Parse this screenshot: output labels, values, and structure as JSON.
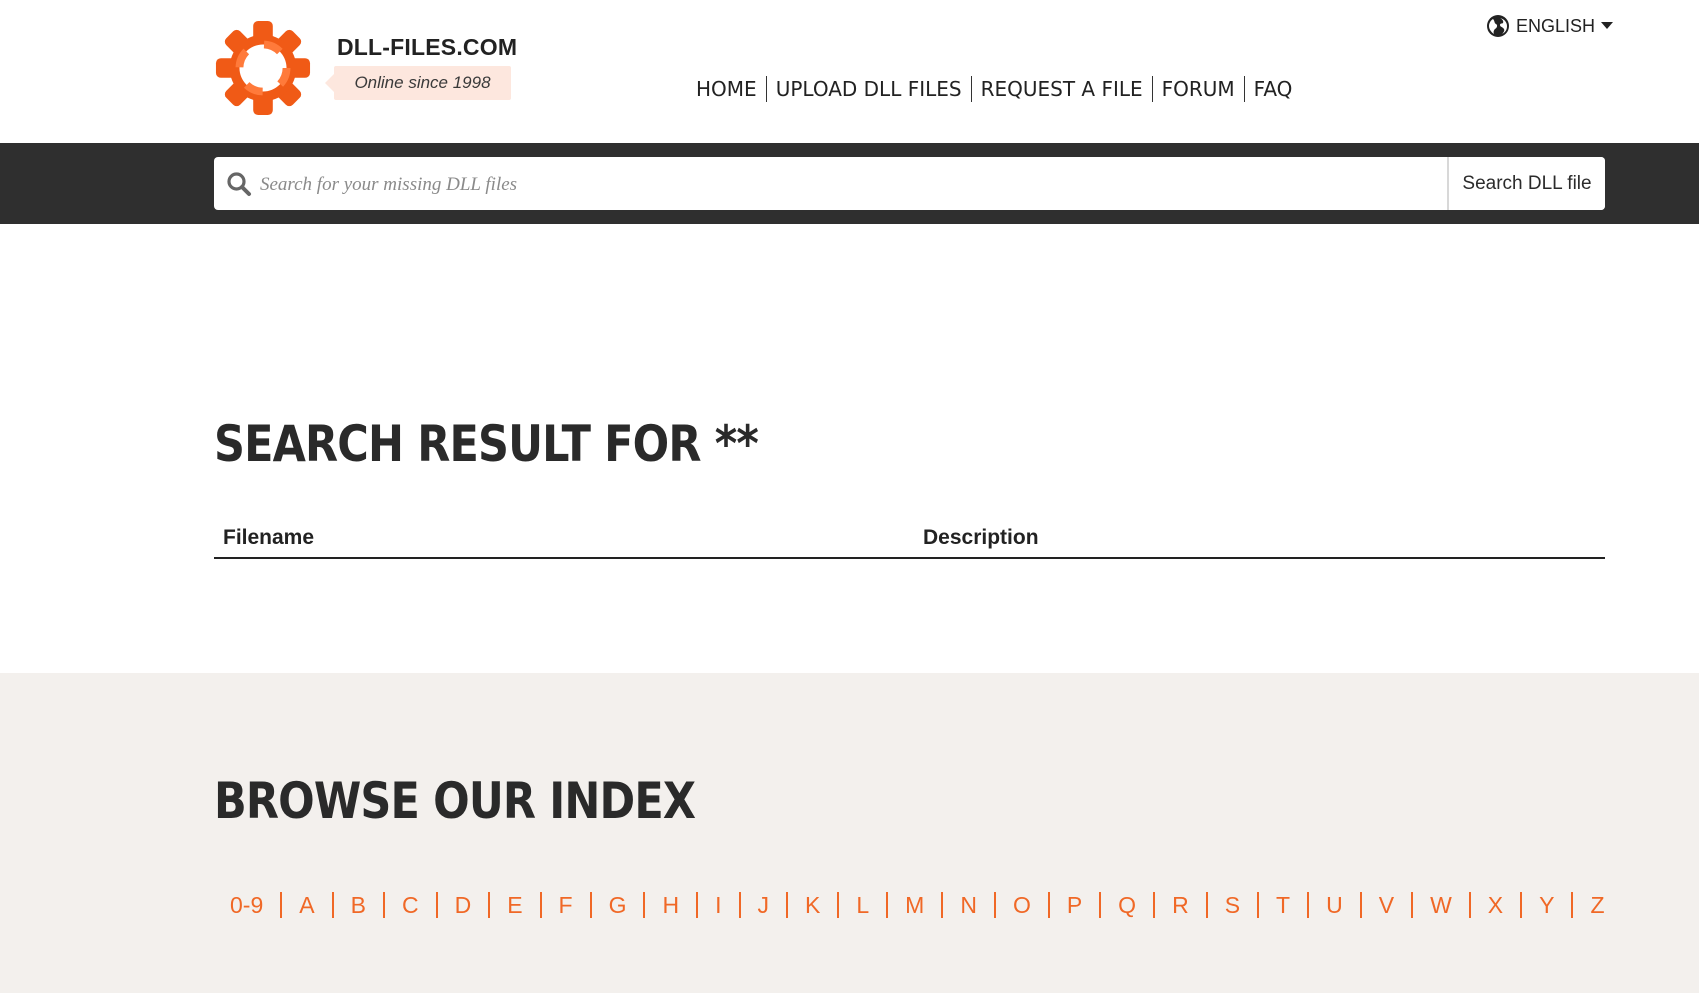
{
  "header": {
    "brand": "DLL-FILES.COM",
    "tagline": "Online since 1998",
    "language": "ENGLISH",
    "nav": [
      "HOME",
      "UPLOAD DLL FILES",
      "REQUEST A FILE",
      "FORUM",
      "FAQ"
    ]
  },
  "search": {
    "placeholder": "Search for your missing DLL files",
    "value": "",
    "button_label": "Search DLL file"
  },
  "results": {
    "title": "SEARCH RESULT FOR **",
    "columns": [
      "Filename",
      "Description"
    ]
  },
  "browse": {
    "title": "BROWSE OUR INDEX",
    "letters": [
      "0-9",
      "A",
      "B",
      "C",
      "D",
      "E",
      "F",
      "G",
      "H",
      "I",
      "J",
      "K",
      "L",
      "M",
      "N",
      "O",
      "P",
      "Q",
      "R",
      "S",
      "T",
      "U",
      "V",
      "W",
      "X",
      "Y",
      "Z"
    ]
  },
  "colors": {
    "accent": "#f06826",
    "dark_bar": "#2f2f2f",
    "browse_bg": "#f3f0ed",
    "tagline_bg": "#fde7de"
  },
  "icons": {
    "logo": "gear-lifebuoy-logo",
    "language": "globe-icon",
    "dropdown": "caret-down-icon",
    "search": "search-icon"
  }
}
